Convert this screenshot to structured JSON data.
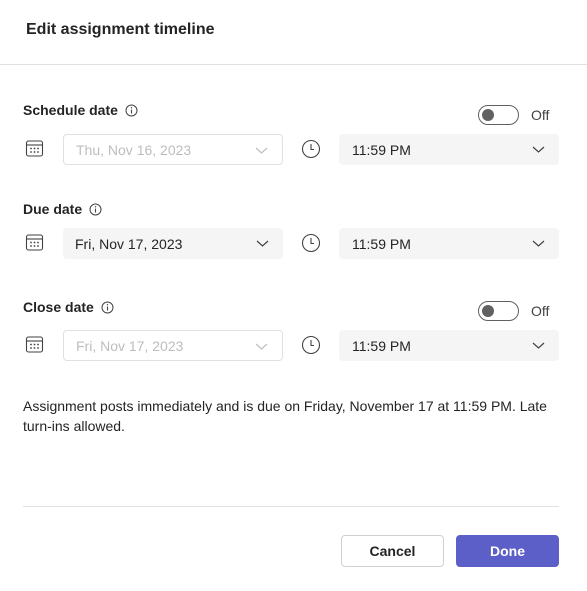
{
  "dialog": {
    "title": "Edit assignment timeline"
  },
  "schedule": {
    "label": "Schedule date",
    "toggle_state": "Off",
    "date": "Thu, Nov 16, 2023",
    "time": "11:59 PM"
  },
  "due": {
    "label": "Due date",
    "date": "Fri, Nov 17, 2023",
    "time": "11:59 PM"
  },
  "close": {
    "label": "Close date",
    "toggle_state": "Off",
    "date": "Fri, Nov 17, 2023",
    "time": "11:59 PM"
  },
  "summary": "Assignment posts immediately and is due on Friday, November 17 at 11:59 PM. Late turn-ins allowed.",
  "buttons": {
    "cancel": "Cancel",
    "done": "Done"
  },
  "colors": {
    "primary": "#5b5fc7",
    "field_bg": "#f5f5f5",
    "disabled_text": "#bdbdbd"
  },
  "icons": {
    "info": "info-icon",
    "calendar": "calendar-icon",
    "clock": "clock-icon",
    "chevron": "chevron-down-icon"
  }
}
